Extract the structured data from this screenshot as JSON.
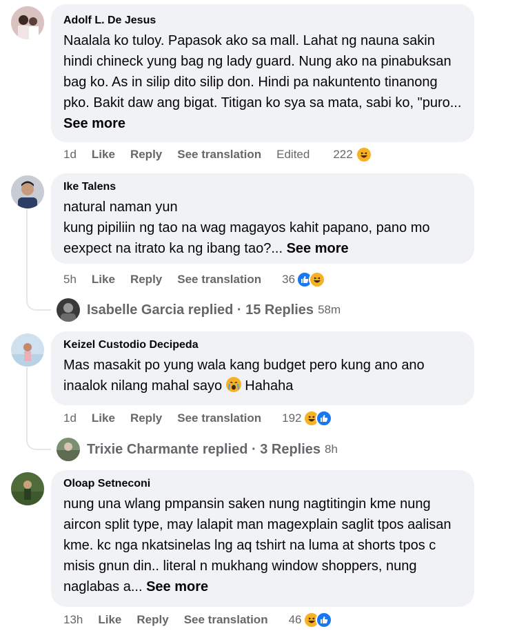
{
  "comments": [
    {
      "author": "Adolf L. De Jesus",
      "text": "Naalala ko tuloy. Papasok ako sa mall. Lahat ng nauna sakin hindi chineck yung bag ng lady guard. Nung ako na pinabuksan bag ko. As in silip dito silip don. Hindi pa nakuntento tinanong pko. Bakit daw ang bigat. Titigan ko sya sa mata, sabi ko, \"puro...",
      "see_more": "See more",
      "time": "1d",
      "like": "Like",
      "reply": "Reply",
      "translate": "See translation",
      "edited": "Edited",
      "reaction_count": "222",
      "reactions": [
        "haha-icon"
      ]
    },
    {
      "author": "Ike Talens",
      "text_lines": [
        "natural naman yun",
        "kung pipiliin ng tao na wag magayos kahit papano, pano mo eexpect na itrato ka ng ibang tao?..."
      ],
      "see_more": "See more",
      "time": "5h",
      "like": "Like",
      "reply": "Reply",
      "translate": "See translation",
      "reaction_count": "36",
      "reactions": [
        "like-icon",
        "haha-icon"
      ],
      "replied": {
        "text": "Isabelle Garcia replied · 15 Replies",
        "time": "58m"
      }
    },
    {
      "author": "Keizel Custodio Decipeda",
      "text_before": "Mas masakit po yung wala kang budget pero kung ano ano inaalok nilang mahal sayo",
      "emoji": "crying-face-icon",
      "text_after": "Hahaha",
      "time": "1d",
      "like": "Like",
      "reply": "Reply",
      "translate": "See translation",
      "reaction_count": "192",
      "reactions": [
        "haha-icon",
        "like-icon"
      ],
      "replied": {
        "text": "Trixie Charmante replied · 3 Replies",
        "time": "8h"
      }
    },
    {
      "author": "Oloap Setneconi",
      "text": "nung una wlang pmpansin saken nung nagtitingin kme nung aircon split type, may lalapit man magexplain saglit tpos aalisan kme. kc nga nkatsinelas lng aq tshirt na luma at shorts tpos c misis gnun din.. literal n mukhang window shoppers, nung naglabas a...",
      "see_more": "See more",
      "time": "13h",
      "like": "Like",
      "reply": "Reply",
      "translate": "See translation",
      "reaction_count": "46",
      "reactions": [
        "haha-icon",
        "like-icon"
      ]
    }
  ],
  "colors": {
    "bubble": "#f0f2f5",
    "meta": "#65676b",
    "like": "#1877f2",
    "haha": "#f7b125"
  }
}
